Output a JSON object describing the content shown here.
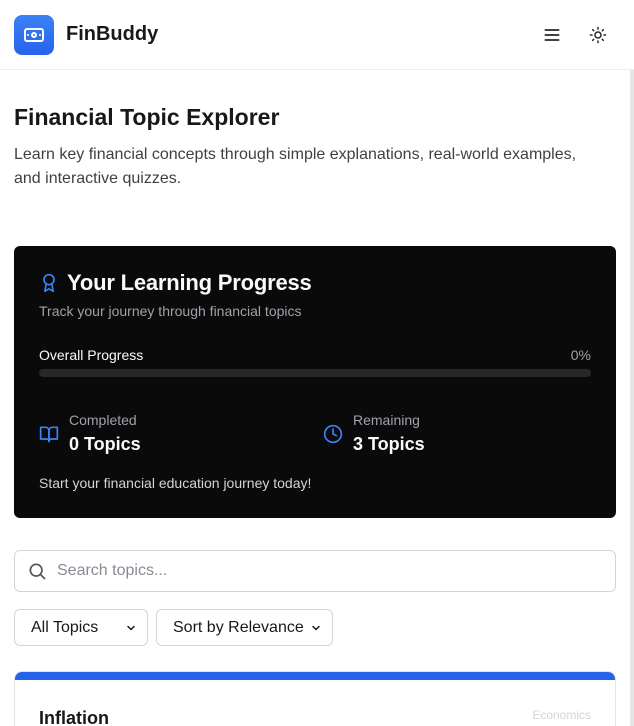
{
  "header": {
    "app_name": "FinBuddy",
    "logo_icon": "banknote-icon",
    "menu_icon": "menu-icon",
    "theme_icon": "sun-icon",
    "brand_color": "#2563eb"
  },
  "intro": {
    "title": "Financial Topic Explorer",
    "description": "Learn key financial concepts through simple explanations, real-world examples, and interactive quizzes."
  },
  "progress": {
    "title": "Your Learning Progress",
    "title_icon": "award-icon",
    "subtitle": "Track your journey through financial topics",
    "overall_label": "Overall Progress",
    "overall_value": "0%",
    "overall_fraction": 0,
    "completed": {
      "label": "Completed",
      "value": "0 Topics",
      "icon": "book-open-icon"
    },
    "remaining": {
      "label": "Remaining",
      "value": "3 Topics",
      "icon": "clock-icon"
    },
    "footer": "Start your financial education journey today!",
    "accent_color": "#3b82f6",
    "background_color": "#0a0a0b"
  },
  "search": {
    "placeholder": "Search topics...",
    "value": "",
    "icon": "search-icon"
  },
  "filters": {
    "category_selected": "All Topics",
    "sort_selected": "Sort by Relevance"
  },
  "topics": [
    {
      "name": "Inflation",
      "tag": "Economics"
    }
  ]
}
